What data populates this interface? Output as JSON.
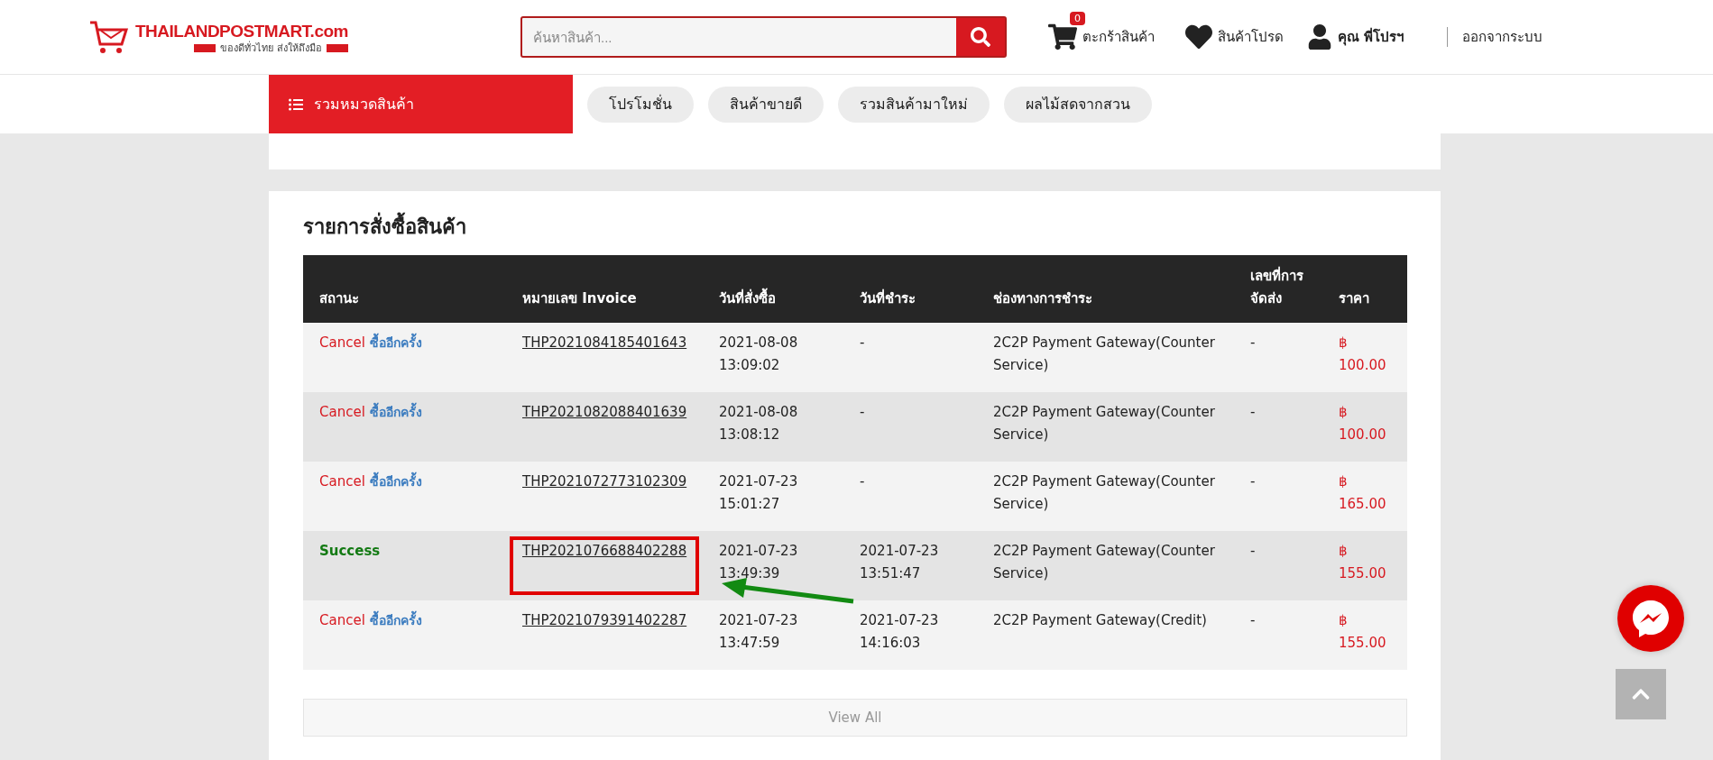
{
  "header": {
    "logo_title": "THAILANDPOSTMART.com",
    "logo_tagline": "ของดีทั่วไทย ส่งให้ถึงมือ",
    "search": {
      "placeholder": "ค้นหาสินค้า..."
    },
    "cart": {
      "label": "ตะกร้าสินค้า",
      "count": "0"
    },
    "favorites": {
      "label": "สินค้าโปรด"
    },
    "user": {
      "prefix": "คุณ",
      "name": "พี่โปรฯ"
    },
    "logout": "ออกจากระบบ"
  },
  "nav": {
    "categories": "รวมหมวดสินค้า",
    "pills": [
      "โปรโมชั่น",
      "สินค้าขายดี",
      "รวมสินค้ามาใหม่",
      "ผลไม้สดจากสวน"
    ]
  },
  "orders": {
    "title": "รายการสั่งซื้อสินค้า",
    "columns": [
      "สถานะ",
      "หมายเลข Invoice",
      "วันที่สั่งซื้อ",
      "วันที่ชำระ",
      "ช่องทางการชำระ",
      "เลขที่การจัดส่ง",
      "ราคา"
    ],
    "rows": [
      {
        "status": "Cancel",
        "kind": "cancel",
        "reorder": "ซื้ออีกครั้ง",
        "invoice": "THP2021084185401643",
        "order_date": "2021-08-08 13:09:02",
        "paid_date": "-",
        "channel": "2C2P Payment Gateway(Counter Service)",
        "tracking": "-",
        "currency": "฿",
        "price": "100.00",
        "highlighted": false
      },
      {
        "status": "Cancel",
        "kind": "cancel",
        "reorder": "ซื้ออีกครั้ง",
        "invoice": "THP2021082088401639",
        "order_date": "2021-08-08 13:08:12",
        "paid_date": "-",
        "channel": "2C2P Payment Gateway(Counter Service)",
        "tracking": "-",
        "currency": "฿",
        "price": "100.00",
        "highlighted": false
      },
      {
        "status": "Cancel",
        "kind": "cancel",
        "reorder": "ซื้ออีกครั้ง",
        "invoice": "THP2021072773102309",
        "order_date": "2021-07-23 15:01:27",
        "paid_date": "-",
        "channel": "2C2P Payment Gateway(Counter Service)",
        "tracking": "-",
        "currency": "฿",
        "price": "165.00",
        "highlighted": false
      },
      {
        "status": "Success",
        "kind": "success",
        "invoice": "THP2021076688402288",
        "order_date": "2021-07-23 13:49:39",
        "paid_date": "2021-07-23 13:51:47",
        "channel": "2C2P Payment Gateway(Counter Service)",
        "tracking": "-",
        "currency": "฿",
        "price": "155.00",
        "highlighted": true
      },
      {
        "status": "Cancel",
        "kind": "cancel",
        "reorder": "ซื้ออีกครั้ง",
        "invoice": "THP2021079391402287",
        "order_date": "2021-07-23 13:47:59",
        "paid_date": "2021-07-23 14:16:03",
        "channel": "2C2P Payment Gateway(Credit)",
        "tracking": "-",
        "currency": "฿",
        "price": "155.00",
        "highlighted": false
      }
    ],
    "view_all": "View All"
  }
}
